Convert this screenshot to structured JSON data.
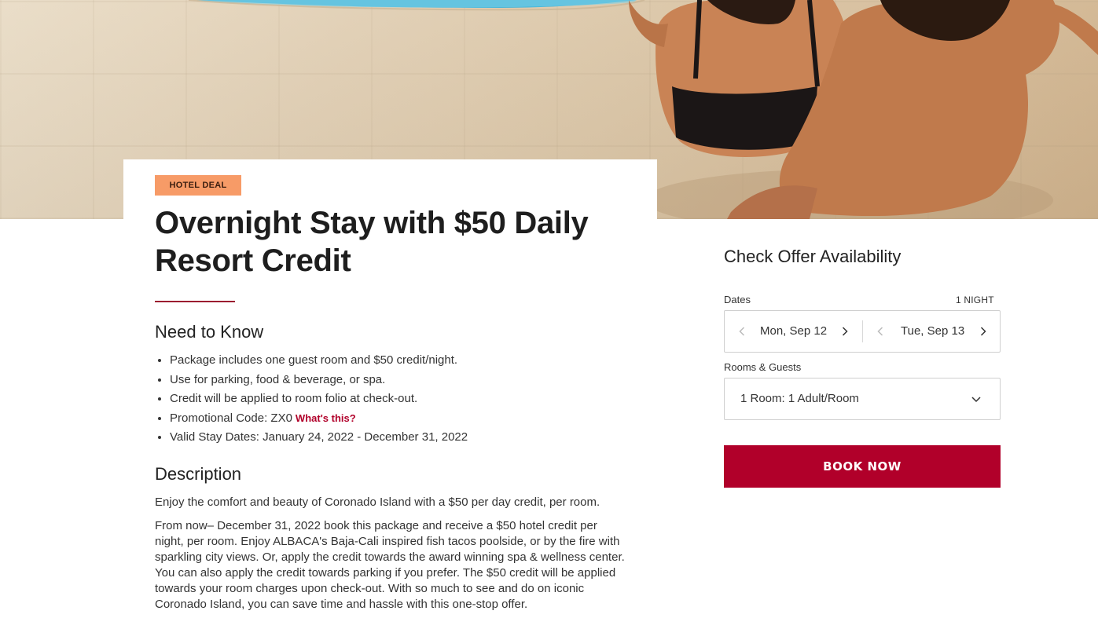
{
  "hero": {
    "alt_subject": "couple-at-pool-edge"
  },
  "deal": {
    "badge": "HOTEL DEAL",
    "title": "Overnight Stay with $50 Daily Resort Credit"
  },
  "need_to_know": {
    "heading": "Need to Know",
    "items": [
      "Package includes one guest room and $50 credit/night.",
      "Use for parking, food & beverage, or spa.",
      "Credit will be applied to room folio at check-out.",
      "Promotional Code: ZX0",
      "Valid Stay Dates: January 24, 2022 - December 31, 2022"
    ],
    "whats_this_link": "What's this?"
  },
  "description": {
    "heading": "Description",
    "paragraphs": [
      "Enjoy the comfort and beauty of Coronado Island with a $50 per day credit, per room.",
      "From now– December 31, 2022 book this package and receive a $50 hotel credit per night, per room. Enjoy ALBACA's Baja-Cali inspired fish tacos poolside, or by the fire with sparkling city views. Or, apply the credit towards the award winning spa & wellness center. You can also apply the credit towards parking if you prefer. The $50 credit will be applied towards your room charges upon check-out. With so much to see and do on iconic Coronado Island, you can save time and hassle with this one-stop offer."
    ]
  },
  "booking": {
    "title": "Check Offer Availability",
    "dates_label": "Dates",
    "nights": "1 NIGHT",
    "check_in": "Mon, Sep 12",
    "check_out": "Tue, Sep 13",
    "rooms_label": "Rooms & Guests",
    "rooms_value": "1 Room: 1 Adult/Room",
    "book_button": "BOOK NOW"
  },
  "colors": {
    "accent": "#b1002a",
    "badge": "#f79b67",
    "rule": "#9b1b30"
  }
}
